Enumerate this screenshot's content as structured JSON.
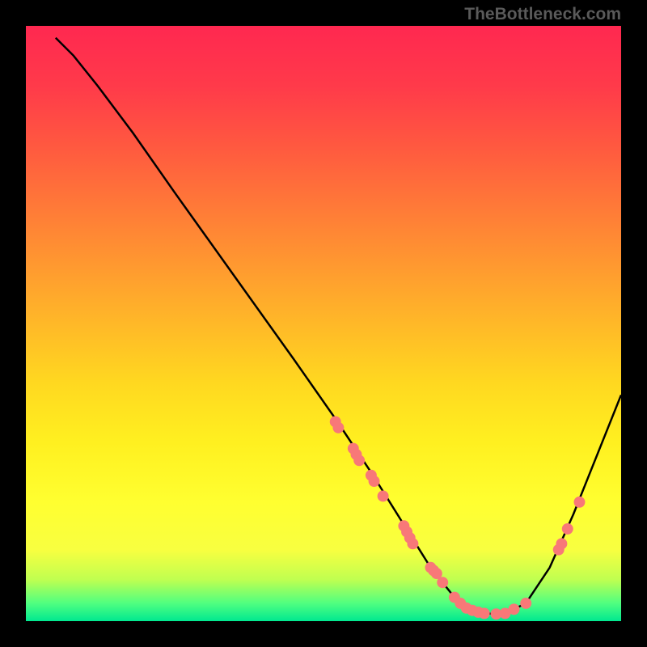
{
  "watermark": "TheBottleneck.com",
  "chart_data": {
    "type": "line",
    "title": "",
    "xlabel": "",
    "ylabel": "",
    "xlim": [
      0,
      100
    ],
    "ylim": [
      0,
      100
    ],
    "curve": [
      {
        "x": 5,
        "y": 98
      },
      {
        "x": 8,
        "y": 95
      },
      {
        "x": 12,
        "y": 90
      },
      {
        "x": 18,
        "y": 82
      },
      {
        "x": 25,
        "y": 72
      },
      {
        "x": 35,
        "y": 58
      },
      {
        "x": 45,
        "y": 44
      },
      {
        "x": 52,
        "y": 34
      },
      {
        "x": 58,
        "y": 25
      },
      {
        "x": 63,
        "y": 17
      },
      {
        "x": 68,
        "y": 9
      },
      {
        "x": 72,
        "y": 4
      },
      {
        "x": 76,
        "y": 1.5
      },
      {
        "x": 80,
        "y": 1
      },
      {
        "x": 84,
        "y": 3
      },
      {
        "x": 88,
        "y": 9
      },
      {
        "x": 92,
        "y": 18
      },
      {
        "x": 96,
        "y": 28
      },
      {
        "x": 100,
        "y": 38
      }
    ],
    "points": [
      {
        "x": 52,
        "y": 33.5
      },
      {
        "x": 52.5,
        "y": 32.5
      },
      {
        "x": 55,
        "y": 29
      },
      {
        "x": 55.5,
        "y": 28
      },
      {
        "x": 56,
        "y": 27
      },
      {
        "x": 58,
        "y": 24.5
      },
      {
        "x": 58.5,
        "y": 23.5
      },
      {
        "x": 60,
        "y": 21
      },
      {
        "x": 63.5,
        "y": 16
      },
      {
        "x": 64,
        "y": 15
      },
      {
        "x": 64.5,
        "y": 14
      },
      {
        "x": 65,
        "y": 13
      },
      {
        "x": 68,
        "y": 9
      },
      {
        "x": 68.5,
        "y": 8.5
      },
      {
        "x": 69,
        "y": 8
      },
      {
        "x": 70,
        "y": 6.5
      },
      {
        "x": 72,
        "y": 4
      },
      {
        "x": 73,
        "y": 3
      },
      {
        "x": 74,
        "y": 2.2
      },
      {
        "x": 75,
        "y": 1.8
      },
      {
        "x": 76,
        "y": 1.5
      },
      {
        "x": 77,
        "y": 1.3
      },
      {
        "x": 79,
        "y": 1.2
      },
      {
        "x": 80.5,
        "y": 1.3
      },
      {
        "x": 82,
        "y": 2
      },
      {
        "x": 84,
        "y": 3
      },
      {
        "x": 89.5,
        "y": 12
      },
      {
        "x": 90,
        "y": 13
      },
      {
        "x": 91,
        "y": 15.5
      },
      {
        "x": 93,
        "y": 20
      }
    ],
    "point_color": "#f87878",
    "point_radius": 7
  }
}
